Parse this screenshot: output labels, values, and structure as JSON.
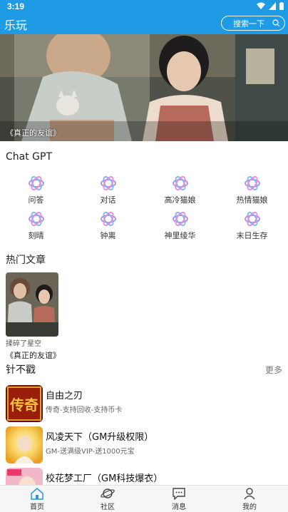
{
  "status": {
    "time": "3:19"
  },
  "app_bar": {
    "title": "乐玩",
    "search_placeholder": "搜索一下"
  },
  "banner": {
    "caption": "《真正的友谊》"
  },
  "chat_gpt": {
    "title": "Chat GPT",
    "items": [
      {
        "label": "问答"
      },
      {
        "label": "对话"
      },
      {
        "label": "高冷猫娘"
      },
      {
        "label": "热情猫娘"
      },
      {
        "label": "刻晴"
      },
      {
        "label": "钟离"
      },
      {
        "label": "神里绫华"
      },
      {
        "label": "末日生存"
      }
    ]
  },
  "hot_articles": {
    "title": "热门文章",
    "items": [
      {
        "subtitle": "揉碎了星空",
        "title": "《真正的友谊》"
      }
    ]
  },
  "games": {
    "title": "针不戳",
    "more": "更多",
    "items": [
      {
        "name": "自由之刃",
        "desc": "传奇-支持回收-支持币卡",
        "badge": "传奇"
      },
      {
        "name": "风凌天下（GM升级权限）",
        "desc": "GM-送满级VIP-送1000元宝"
      },
      {
        "name": "校花梦工厂（GM科技爆衣）",
        "desc": ""
      }
    ]
  },
  "bottom_nav": {
    "items": [
      {
        "label": "首页"
      },
      {
        "label": "社区"
      },
      {
        "label": "消息"
      },
      {
        "label": "我的"
      }
    ]
  },
  "colors": {
    "primary": "#1e9be4",
    "nav_bg": "#f6f6f6"
  }
}
